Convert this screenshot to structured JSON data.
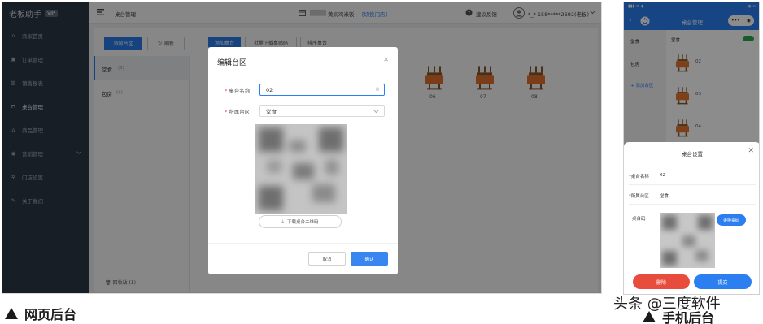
{
  "desktop": {
    "brand": "老板助手",
    "brand_badge": "VIP",
    "nav": [
      {
        "label": "商家首页",
        "icon": "home-icon"
      },
      {
        "label": "订单管理",
        "icon": "order-icon"
      },
      {
        "label": "销售报表",
        "icon": "chart-icon"
      },
      {
        "label": "桌台管理",
        "icon": "table-icon",
        "active": true
      },
      {
        "label": "商品管理",
        "icon": "goods-icon"
      },
      {
        "label": "营销管理",
        "icon": "marketing-icon",
        "arrow": true
      },
      {
        "label": "门店设置",
        "icon": "gear-icon"
      },
      {
        "label": "关于我们",
        "icon": "about-icon"
      }
    ],
    "topbar": {
      "page": "桌台管理",
      "shop": "黄焖鸡米饭",
      "switch_shop": "[切换门店]",
      "feedback": "建议反馈",
      "user": "*_* 158*****2692(老板)"
    },
    "toolbar": {
      "add_area": "添加台区",
      "refresh": "刷新",
      "add_table": "添加桌台",
      "batch_download": "批量下载桌贴码",
      "sort_table": "排序桌台"
    },
    "areas": [
      {
        "name": "堂食",
        "count": "(8)"
      },
      {
        "name": "包房",
        "count": "(4)"
      }
    ],
    "recycle": "回收站 (1)",
    "tables": [
      "06",
      "07",
      "08"
    ],
    "modal": {
      "title": "编辑台区",
      "name_label": "桌台名称:",
      "name_value": "02",
      "area_label": "所属台区:",
      "area_value": "堂食",
      "download_label": "下载桌台二维码",
      "cancel": "取消",
      "confirm": "确认"
    },
    "caption": "网页后台"
  },
  "mobile": {
    "title": "桌台管理",
    "categories": [
      "堂食",
      "包房"
    ],
    "add_area": "+ 添加台区",
    "area_header": "堂食",
    "tables": [
      "02",
      "03",
      "04"
    ],
    "sheet": {
      "title": "桌台设置",
      "name_label": "*桌台名称",
      "name_value": "02",
      "area_label": "*所属台区",
      "area_value": "堂食",
      "code_label": "桌台码",
      "change_code": "更换桌码",
      "delete": "删除",
      "submit": "提交"
    },
    "caption": "手机后台"
  },
  "watermark": "头条 @三度软件",
  "colors": {
    "accent": "#2b7ff0",
    "sidebar": "#2d3948",
    "danger": "#e74c3c"
  }
}
